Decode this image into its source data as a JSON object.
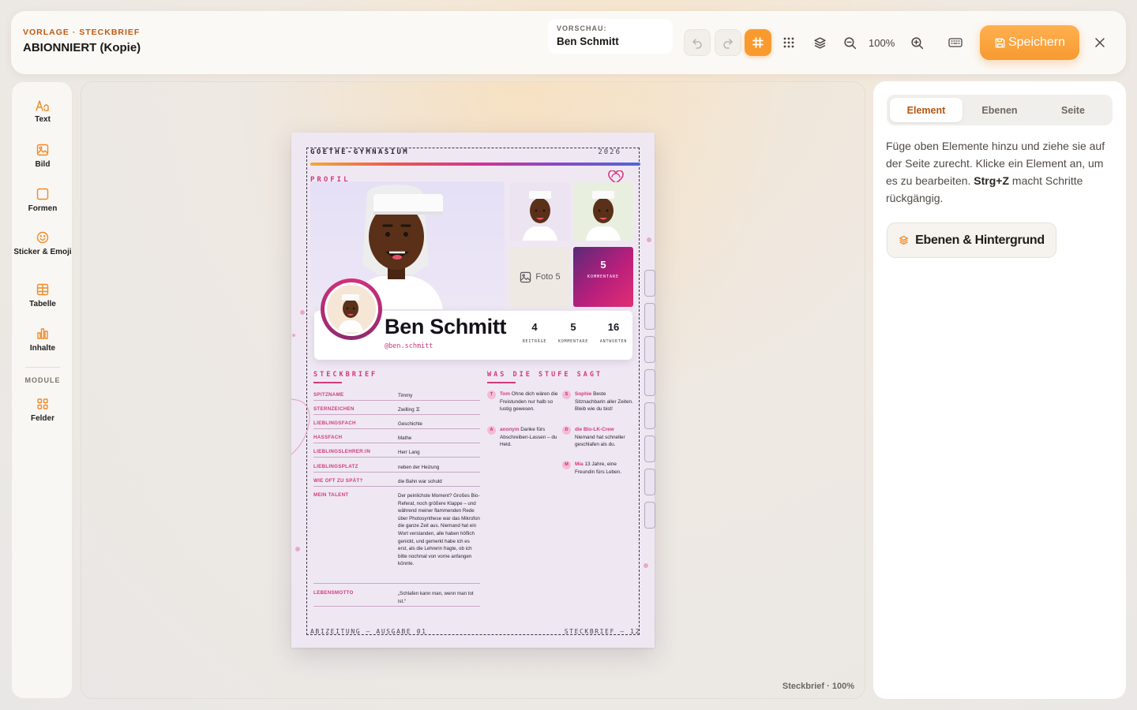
{
  "header": {
    "kicker": "VORLAGE · STECKBRIEF",
    "title": "ABIONNIERT (Kopie)",
    "preview_label": "VORSCHAU:",
    "preview_value": "Ben Schmitt",
    "zoom": "100%",
    "save_label": "Speichern",
    "accent": "#f99a2f"
  },
  "tools": {
    "items": [
      {
        "label": "Text",
        "icon": "text-icon"
      },
      {
        "label": "Bild",
        "icon": "image-icon"
      },
      {
        "label": "Formen",
        "icon": "shape-icon"
      },
      {
        "label": "Sticker & Emoji",
        "icon": "smiley-icon"
      },
      {
        "label": "Tabelle",
        "icon": "table-icon"
      },
      {
        "label": "Inhalte",
        "icon": "chart-icon"
      }
    ],
    "module_heading": "MODULE",
    "module_items": [
      {
        "label": "Felder",
        "icon": "grid-icon"
      }
    ]
  },
  "canvas": {
    "status": "Steckbrief · 100%"
  },
  "page": {
    "school": "GOETHE-GYMNASIUM",
    "year": "2026",
    "profile_label": "PROFIL",
    "photo_placeholder": "Foto 5",
    "highlight": {
      "value": "5",
      "label": "KOMMENTARE"
    },
    "name": "Ben Schmitt",
    "handle": "@ben.schmitt",
    "stats": [
      {
        "value": "4",
        "label": "BEITRÄGE"
      },
      {
        "value": "5",
        "label": "KOMMENTARE"
      },
      {
        "value": "16",
        "label": "ANTWORTEN"
      }
    ],
    "facts_title": "STECKBRIEF",
    "facts": [
      {
        "key": "SPITZNAME",
        "value": "Timmy"
      },
      {
        "key": "STERNZEICHEN",
        "value": "Zwilling ♊"
      },
      {
        "key": "LIEBLINGSFACH",
        "value": "Geschichte"
      },
      {
        "key": "HASSFACH",
        "value": "Mathe"
      },
      {
        "key": "LIEBLINGSLEHRER:IN",
        "value": "Herr Lang"
      },
      {
        "key": "LIEBLINGSPLATZ",
        "value": "neben der Heizung"
      },
      {
        "key": "WIE OFT ZU SPÄT?",
        "value": "die Bahn war schuld"
      },
      {
        "key": "MEIN TALENT",
        "value": "Der peinlichste Moment? Großes Bio-Referat, noch größere Klappe – und während meiner flammenden Rede über Photosynthese war das Mikrofon die ganze Zeit aus. Niemand hat ein Wort verstanden, alle haben höflich genickt, und gemerkt habe ich es erst, als die Lehrerin fragte, ob ich bitte nochmal von vorne anfangen könnte."
      },
      {
        "key": "LEBENSMOTTO",
        "value": "„Schlafen kann man, wenn man tot ist.“"
      }
    ],
    "quotes_title": "WAS DIE STUFE SAGT",
    "quotes": [
      {
        "initial": "T",
        "author": "Tom",
        "text": "Ohne dich wären die Freistunden nur halb so lustig gewesen."
      },
      {
        "initial": "S",
        "author": "Sophie",
        "text": "Beste Sitznachbarin aller Zeiten. Bleib wie du bist!"
      },
      {
        "initial": "A",
        "author": "anonym",
        "text": "Danke fürs Abschreiben-Lassen – du Held."
      },
      {
        "initial": "D",
        "author": "die Bio-LK-Crew",
        "text": "Niemand hat schneller geschlafen als du."
      },
      {
        "initial": "M",
        "author": "Mia",
        "text": "13 Jahre, eine Freundin fürs Leben."
      }
    ],
    "footer_left": "ABIZEITUNG — AUSGABE 01",
    "footer_right": "STECKBRIEF — 12"
  },
  "panel": {
    "tabs": [
      {
        "label": "Element",
        "active": true
      },
      {
        "label": "Ebenen",
        "active": false
      },
      {
        "label": "Seite",
        "active": false
      }
    ],
    "help_text_1": "Füge oben Elemente hinzu und ziehe sie auf der Seite zurecht. Klicke ein Element an, um es zu bearbeiten. ",
    "help_shortcut": "Strg+Z",
    "help_text_2": " macht Schritte rückgängig.",
    "layers_button": "Ebenen & Hintergrund"
  }
}
